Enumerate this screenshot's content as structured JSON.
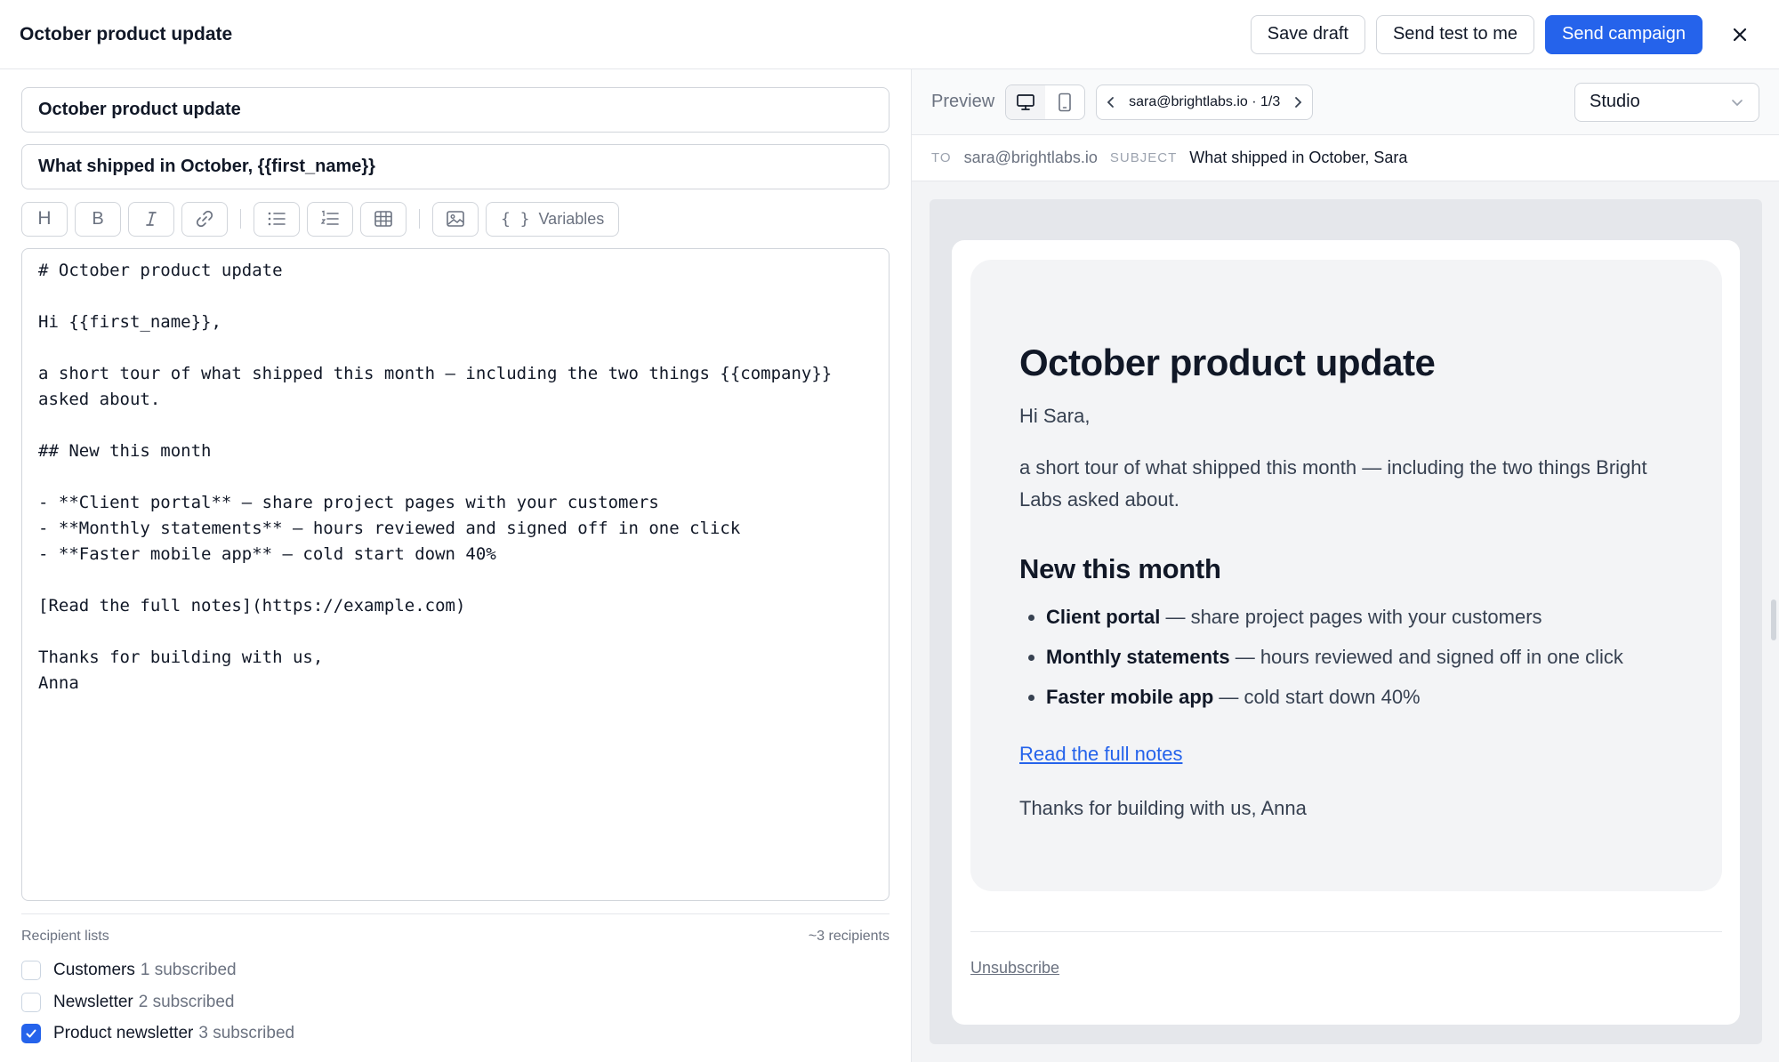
{
  "header": {
    "title": "October product update",
    "save_draft": "Save draft",
    "send_test": "Send test to me",
    "send_campaign": "Send campaign"
  },
  "editor": {
    "subject": "October product update",
    "preheader": "What shipped in October, {{first_name}}",
    "toolbar": {
      "heading": "H",
      "bold": "B",
      "variables": "Variables",
      "variables_brace": "{ }"
    },
    "lines": [
      "# October product update",
      "",
      "Hi {{first_name}},",
      "",
      "a short tour of what shipped this month — including the two things {{company}}",
      "asked about.",
      "",
      "## New this month",
      "",
      "- **Client portal** — share project pages with your customers",
      "- **Monthly statements** — hours reviewed and signed off in one click",
      "- **Faster mobile app** — cold start down 40%",
      "",
      "[Read the full notes](https://example.com)",
      "",
      "Thanks for building with us,",
      "Anna"
    ]
  },
  "recipients": {
    "label": "Recipient lists",
    "count": "~3 recipients",
    "lists": [
      {
        "name": "Customers",
        "subscribed": "1 subscribed",
        "checked": false
      },
      {
        "name": "Newsletter",
        "subscribed": "2 subscribed",
        "checked": false
      },
      {
        "name": "Product newsletter",
        "subscribed": "3 subscribed",
        "checked": true
      }
    ]
  },
  "preview": {
    "label": "Preview",
    "recipient_nav": "sara@brightlabs.io · 1/3",
    "theme": "Studio",
    "to_label": "TO",
    "to_value": "sara@brightlabs.io",
    "subject_label": "SUBJECT",
    "subject_value": "What shipped in October, Sara",
    "email": {
      "title": "October product update",
      "greeting": "Hi Sara,",
      "intro": "a short tour of what shipped this month — including the two things Bright Labs asked about.",
      "section_title": "New this month",
      "items": [
        {
          "bold": "Client portal",
          "rest": " — share project pages with your customers"
        },
        {
          "bold": "Monthly statements",
          "rest": " — hours reviewed and signed off in one click"
        },
        {
          "bold": "Faster mobile app",
          "rest": " — cold start down 40%"
        }
      ],
      "link": "Read the full notes",
      "signoff": "Thanks for building with us, Anna",
      "unsubscribe": "Unsubscribe"
    }
  },
  "colors": {
    "accent": "#2563eb",
    "canvas": "#e5e7eb",
    "card": "#f3f4f6"
  },
  "icons": [
    "close-icon",
    "italic-icon",
    "link-icon",
    "bulleted-list-icon",
    "numbered-list-icon",
    "table-icon",
    "image-icon",
    "desktop-icon",
    "mobile-icon",
    "chevron-left-icon",
    "chevron-right-icon",
    "chevron-down-icon",
    "check-icon"
  ]
}
